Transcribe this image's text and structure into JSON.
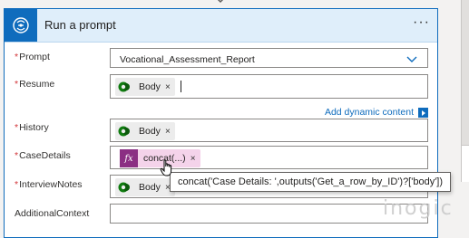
{
  "card": {
    "title": "Run a prompt",
    "more_label": "···",
    "header_icon": "ai-prompt-icon"
  },
  "fields": {
    "prompt": {
      "label": "Prompt",
      "required": true,
      "value": "Vocational_Assessment_Report"
    },
    "resume": {
      "label": "Resume",
      "required": true,
      "token": "Body"
    },
    "history": {
      "label": "History",
      "required": true,
      "token": "Body"
    },
    "case_details": {
      "label": "CaseDetails",
      "required": true,
      "token": "concat(...)"
    },
    "interview_notes": {
      "label": "InterviewNotes",
      "required": true,
      "token": "Body"
    },
    "additional_context": {
      "label": "AdditionalContext",
      "required": false
    }
  },
  "required_marker": "*",
  "token_remove": "×",
  "fx_glyph": "fx",
  "add_dynamic_content": "Add dynamic content",
  "tooltip": "concat('Case Details: ',outputs('Get_a_row_by_ID')?['body'])",
  "watermark": "inogic",
  "colors": {
    "accent": "#0f6cbd",
    "header_bg": "#dfeefa",
    "required": "#d13438",
    "fx_token_bg": "#f4d3ea",
    "fx_icon_bg": "#8b2f83",
    "dataverse_green": "#107c10"
  }
}
